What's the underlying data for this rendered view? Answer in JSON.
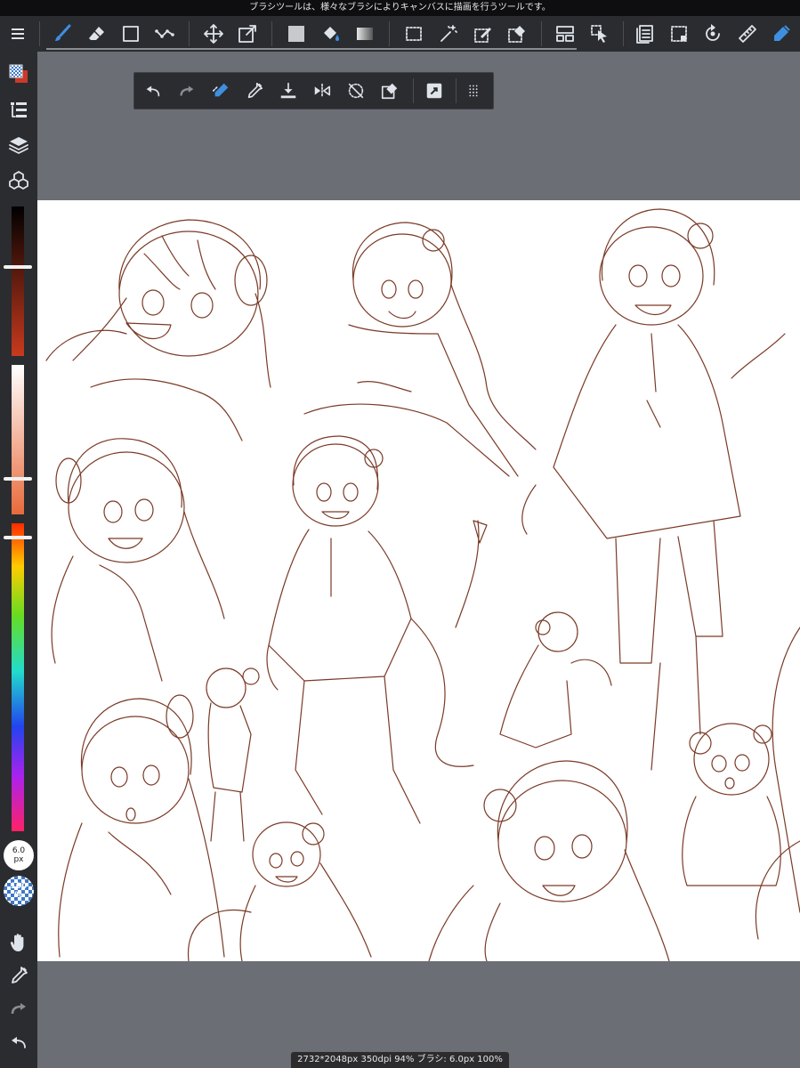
{
  "app": {
    "hint_text": "ブラシツールは、様々なブラシによりキャンバスに描画を行うツールです。",
    "status_text": "2732*2048px 350dpi 94% ブラシ: 6.0px 100%"
  },
  "main_toolbar": {
    "menu_icon": "hamburger-icon",
    "tools": [
      "brush-icon",
      "eraser-icon",
      "shape-rect-icon",
      "shape-line-icon",
      "move-icon",
      "transform-icon",
      "fill-color-icon",
      "bucket-icon",
      "gradient-icon",
      "select-rect-icon",
      "magic-wand-icon",
      "select-pen-icon",
      "select-eraser-icon",
      "panel-icon",
      "operation-icon",
      "layer-menu-icon",
      "select-menu-icon",
      "rotate-icon",
      "ruler-icon",
      "pen-icon"
    ],
    "active_tool": "brush-icon"
  },
  "floating_toolbar": {
    "tools": [
      "undo-icon",
      "redo-icon",
      "snap-pen-icon",
      "eyedropper-icon",
      "import-icon",
      "flip-icon",
      "rotate-off-icon",
      "clear-icon",
      "transform-tool-icon",
      "grid-dots-icon"
    ]
  },
  "sidebar": {
    "tools": [
      "color-swatch-icon",
      "brush-list-icon",
      "layers-icon",
      "materials-icon"
    ],
    "brush_size": {
      "value": "6.0",
      "unit": "px"
    },
    "opacity": {
      "value": "100",
      "unit": "%"
    },
    "bottom_tools": [
      "hand-icon",
      "eyedropper-icon",
      "redo-icon",
      "undo-icon"
    ],
    "slider_levels": {
      "shade": 0.4,
      "tint": 0.75,
      "hue": 0.02
    }
  },
  "colors": {
    "accent": "#3f8fe0",
    "toolbar_bg": "#2a2c30",
    "canvas_bg": "#ffffff",
    "workspace_bg": "#6b6e74",
    "line_color": "#7a3a26"
  }
}
